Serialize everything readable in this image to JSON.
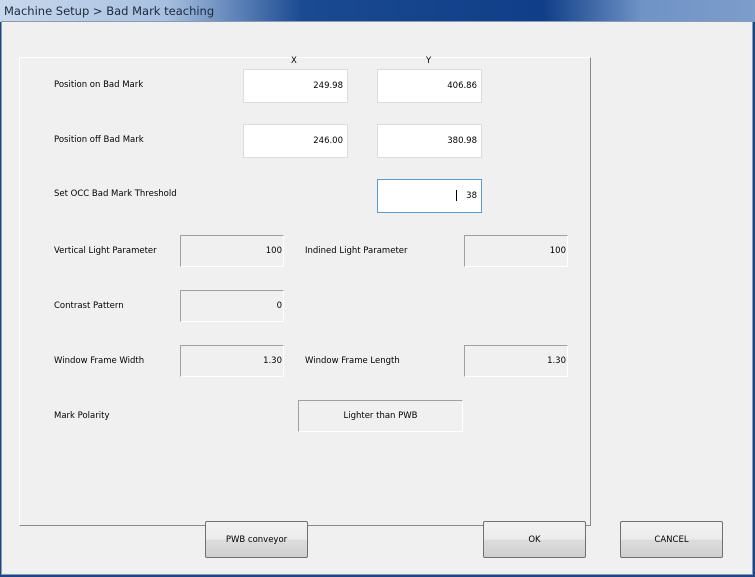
{
  "window": {
    "title": "Machine Setup > Bad Mark teaching"
  },
  "headers": {
    "x": "X",
    "y": "Y"
  },
  "position_on": {
    "label": "Position on Bad Mark",
    "x": "249.98",
    "y": "406.86"
  },
  "position_off": {
    "label": "Position off Bad Mark",
    "x": "246.00",
    "y": "380.98"
  },
  "threshold": {
    "label": "Set OCC Bad Mark Threshold",
    "value": "38"
  },
  "vertical_light": {
    "label": "Vertical Light Parameter",
    "value": "100"
  },
  "inclined_light": {
    "label": "Indined Light Parameter",
    "value": "100"
  },
  "contrast": {
    "label": "Contrast Pattern",
    "value": "0"
  },
  "frame_width": {
    "label": "Window Frame Width",
    "value": "1.30"
  },
  "frame_length": {
    "label": "Window Frame Length",
    "value": "1.30"
  },
  "polarity": {
    "label": "Mark Polarity",
    "value": "Lighter than PWB"
  },
  "buttons": {
    "conveyor": "PWB conveyor",
    "ok": "OK",
    "cancel": "CANCEL"
  }
}
